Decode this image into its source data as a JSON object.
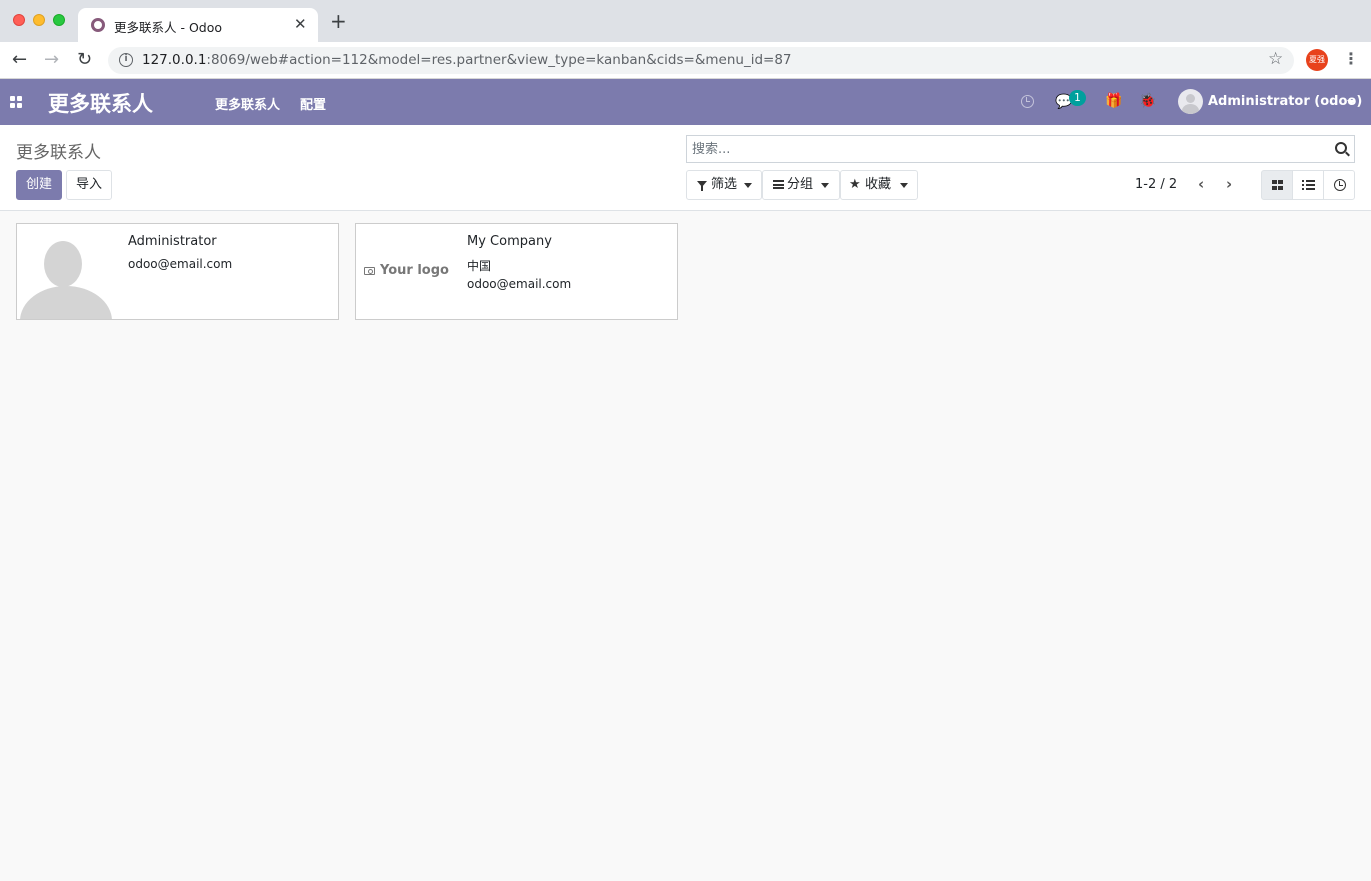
{
  "browser": {
    "tab_title": "更多联系人 - Odoo",
    "url_host": "127.0.0.1",
    "url_rest": ":8069/web#action=112&model=res.partner&view_type=kanban&cids=&menu_id=87",
    "profile_label": "夏强"
  },
  "navbar": {
    "brand": "更多联系人",
    "menu": [
      "更多联系人",
      "配置"
    ],
    "chat_badge": "1",
    "user_name": "Administrator (odoo)",
    "color": "#7c7bad"
  },
  "control_panel": {
    "breadcrumb": "更多联系人",
    "create_label": "创建",
    "import_label": "导入",
    "search_placeholder": "搜索...",
    "filter_label": "筛选",
    "group_label": "分组",
    "favorites_label": "收藏",
    "pager": "1-2 / 2"
  },
  "cards": [
    {
      "name": "Administrator",
      "line1": "odoo@email.com",
      "line2": ""
    },
    {
      "name": "My Company",
      "line1": "中国",
      "line2": "odoo@email.com",
      "logo_text": "Your logo"
    }
  ]
}
